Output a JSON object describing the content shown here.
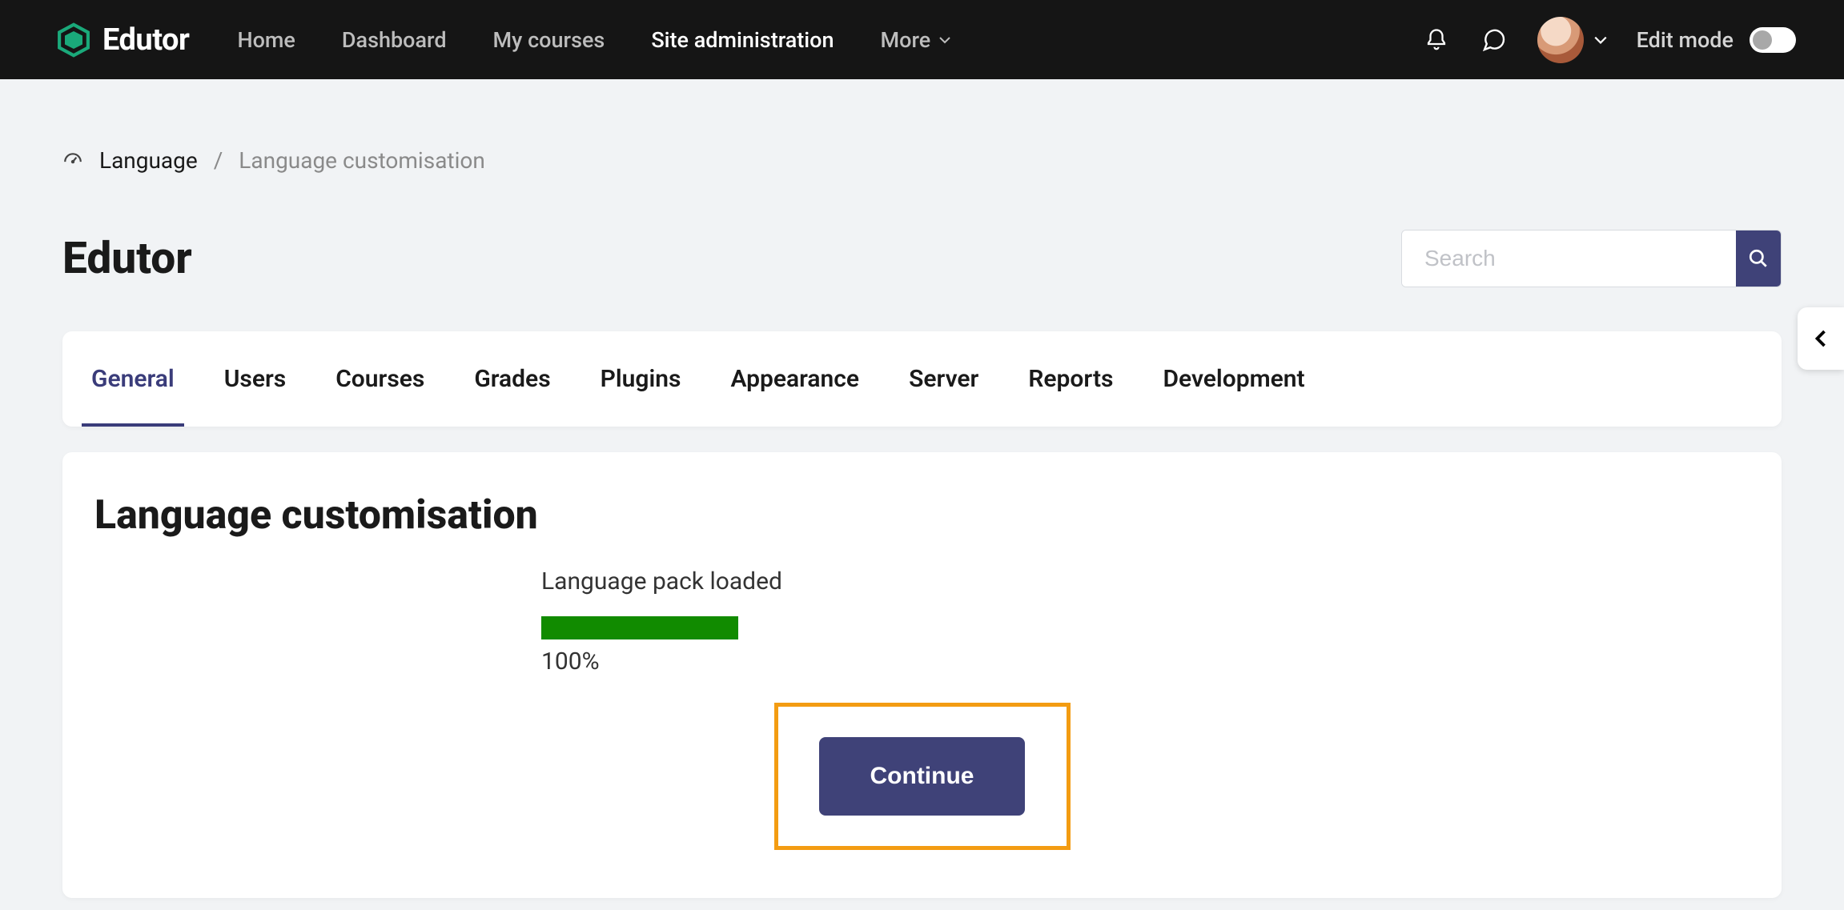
{
  "brand": {
    "name": "Edutor"
  },
  "nav": {
    "items": [
      {
        "label": "Home"
      },
      {
        "label": "Dashboard"
      },
      {
        "label": "My courses"
      },
      {
        "label": "Site administration"
      },
      {
        "label": "More"
      }
    ],
    "active_index": 3,
    "edit_mode_label": "Edit mode"
  },
  "breadcrumb": {
    "root": "Language",
    "current": "Language customisation"
  },
  "site_title": "Edutor",
  "search": {
    "placeholder": "Search"
  },
  "tabs": {
    "items": [
      {
        "label": "General"
      },
      {
        "label": "Users"
      },
      {
        "label": "Courses"
      },
      {
        "label": "Grades"
      },
      {
        "label": "Plugins"
      },
      {
        "label": "Appearance"
      },
      {
        "label": "Server"
      },
      {
        "label": "Reports"
      },
      {
        "label": "Development"
      }
    ],
    "active_index": 0
  },
  "content": {
    "title": "Language customisation",
    "status": "Language pack loaded",
    "progress_pct": "100%",
    "continue_label": "Continue"
  },
  "colors": {
    "nav_bg": "#151515",
    "accent": "#3f4278",
    "progress": "#118b00",
    "highlight_border": "#f39c12"
  }
}
